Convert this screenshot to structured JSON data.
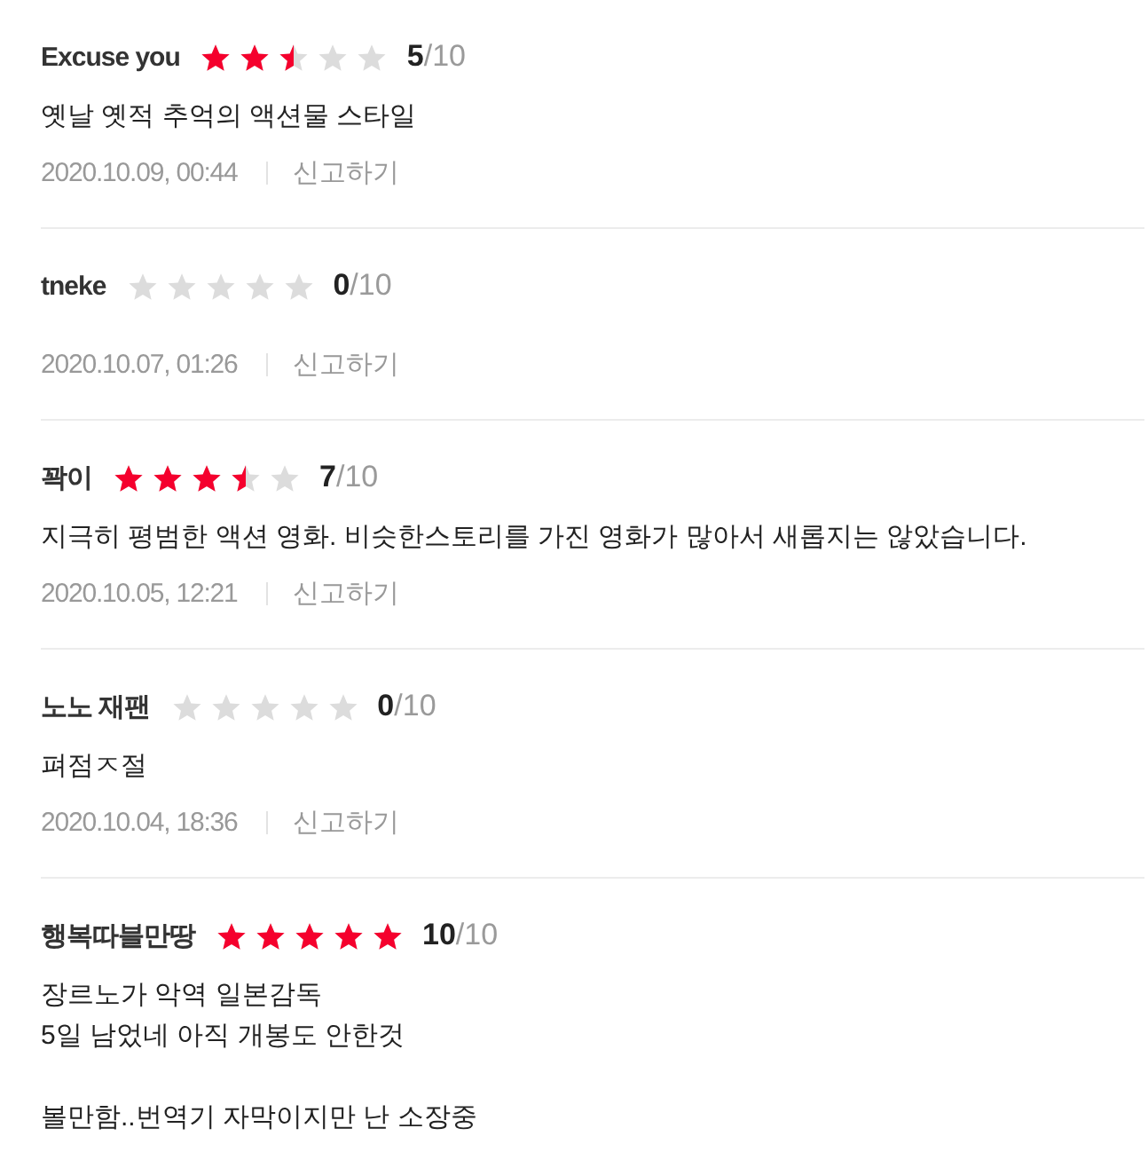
{
  "reviews": [
    {
      "author": "Excuse you",
      "stars": 2.5,
      "score": "**5**/10",
      "comment": "옛날 옛적 추억의 액션물 스타일",
      "date": "2020.10.09, 00:44",
      "report": "신고하기"
    },
    {
      "author": "tneke",
      "stars": 0,
      "score": "**0**/10",
      "date": "2020.10.07, 01:26",
      "report": "신고하기"
    },
    {
      "author": "꽉이",
      "stars": 3.5,
      "score": "**7**/10",
      "comment": "지극히 평범한 액션 영화. 비슷한스토리를 가진 영화가 많아서 새롭지는 않았습니다.",
      "date": "2020.10.05, 12:21",
      "report": "신고하기"
    },
    {
      "author": "노노 재팬",
      "stars": 0,
      "score": "**0**/10",
      "comment": "펴점ㅈ절",
      "date": "2020.10.04, 18:36",
      "report": "신고하기"
    },
    {
      "author": "행복따블만땅",
      "stars": 5,
      "score": "**10**/10",
      "comment": "장르노가 악역 일본감독\n5일 남었네 아직 개봉도 안한것\n\n볼만함..번역기 자막이지만 난 소장중"
    }
  ]
}
